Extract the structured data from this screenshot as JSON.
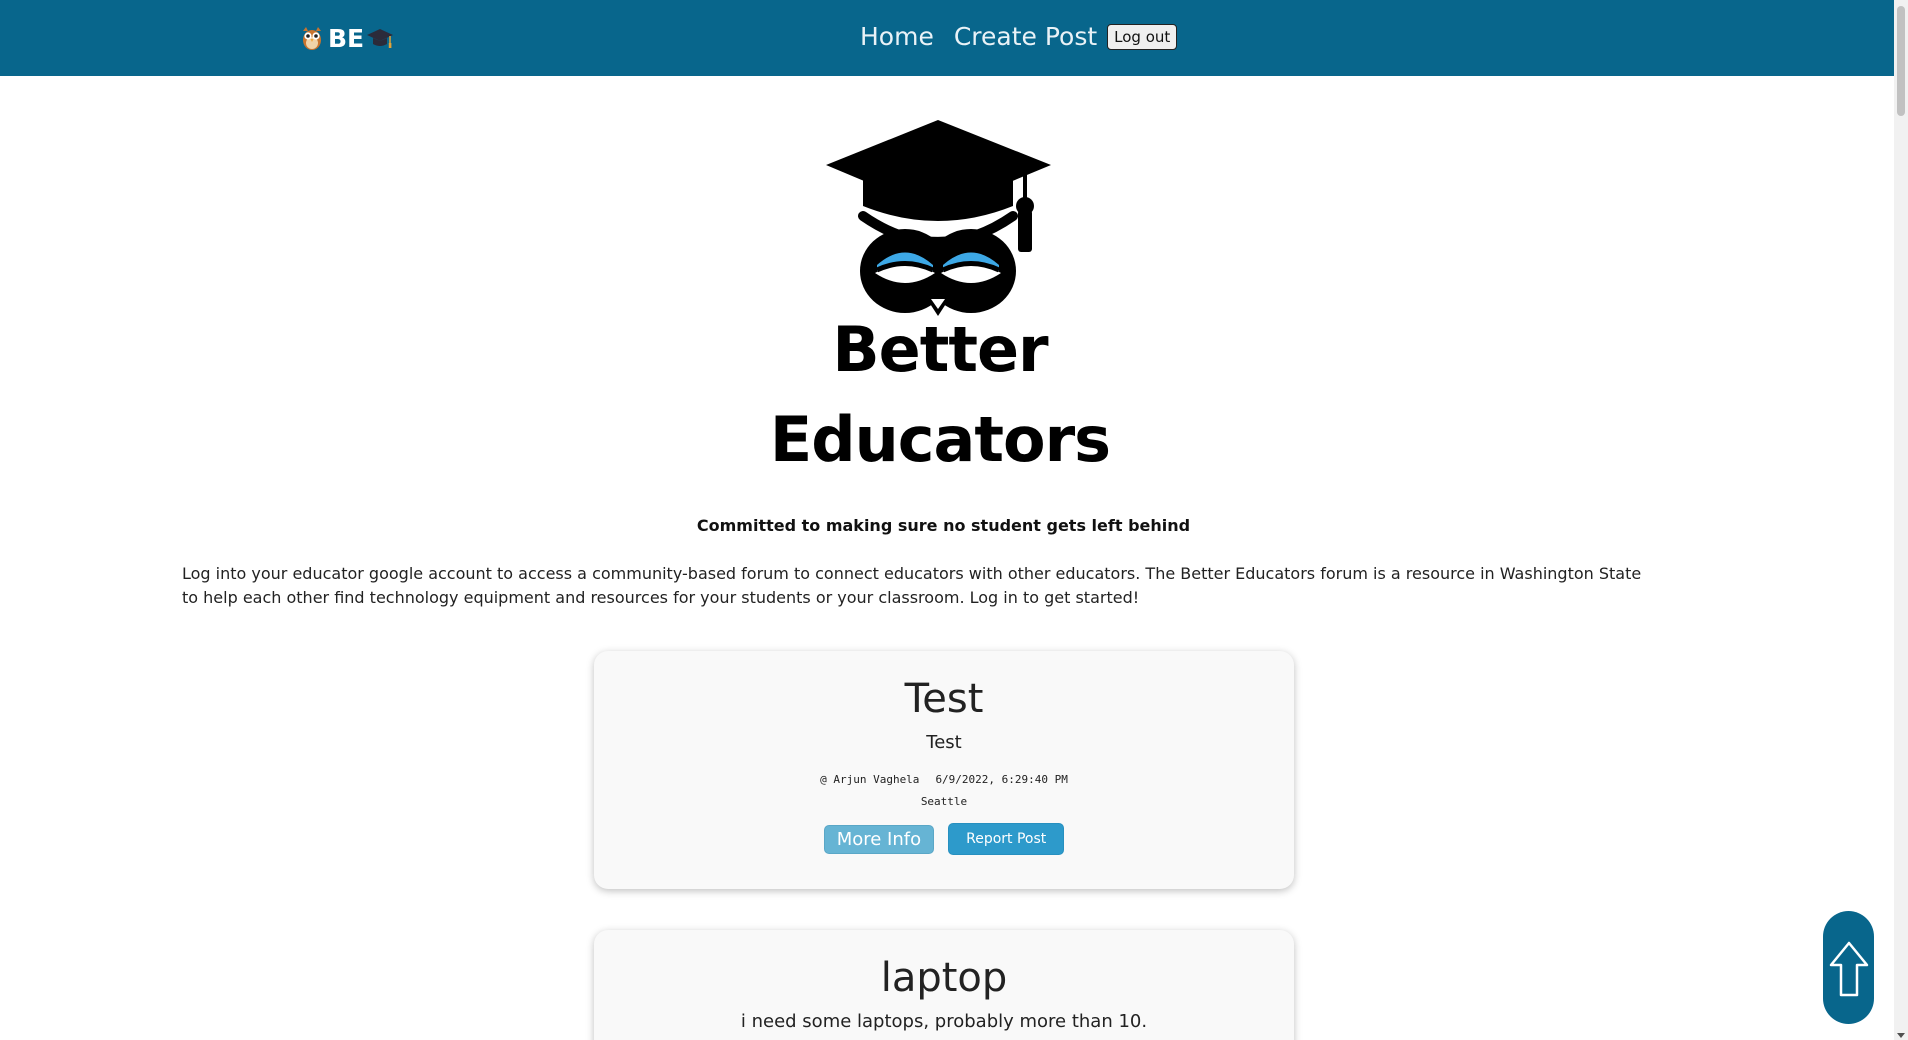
{
  "navbar": {
    "brand_text": "BE",
    "links": [
      "Home",
      "Create Post"
    ],
    "logout_label": "Log out",
    "color": "#08668c"
  },
  "hero": {
    "title_line1": "Better",
    "title_line2": "Educators",
    "tagline": "Committed to making sure no student gets left behind",
    "intro": "Log into your educator google account to access a community-based forum to connect educators with other educators. The Better Educators forum is a resource in Washington State to help each other find technology equipment and resources for your students or your classroom. Log in to get started!"
  },
  "posts": [
    {
      "title": "Test",
      "body": "Test",
      "author": "@ Arjun Vaghela",
      "timestamp": "6/9/2022, 6:29:40 PM",
      "location": "Seattle",
      "more_label": "More Info",
      "report_label": "Report Post"
    },
    {
      "title": "laptop",
      "body": "i need some laptops, probably more than 10."
    }
  ],
  "icons": {
    "brand_owl": "owl-icon",
    "brand_cap": "graduation-cap-icon",
    "hero_logo": "owl-graduation-logo",
    "scroll_top": "arrow-up-icon"
  },
  "colors": {
    "accent": "#08668c",
    "more_button": "#66b4d4",
    "report_button": "#2d9acb",
    "owl_eyes": "#3da8e6"
  }
}
